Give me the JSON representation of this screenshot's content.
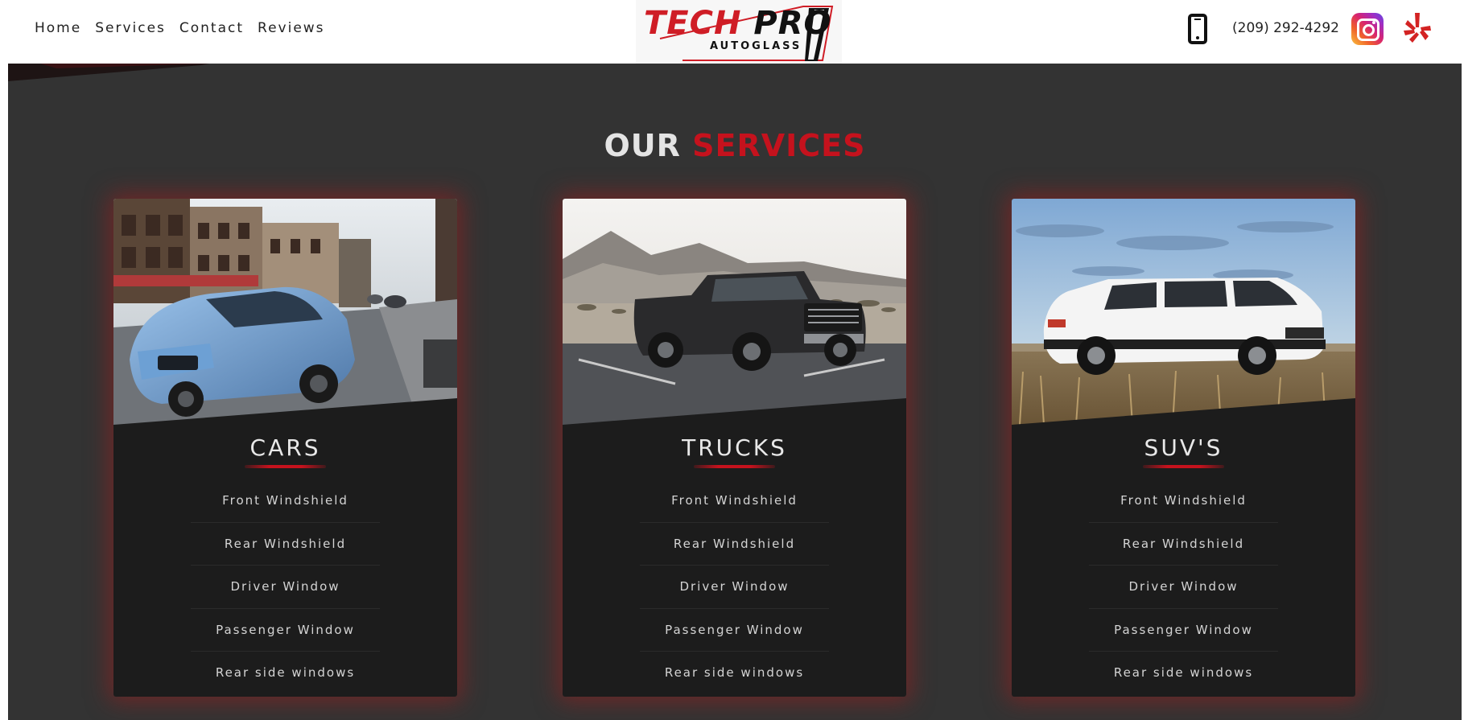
{
  "nav": {
    "items": [
      "Home",
      "Services",
      "Contact",
      "Reviews"
    ]
  },
  "logo": {
    "main_part1": "TECH",
    "main_part2": "PRO",
    "sub": "AUTOGLASS"
  },
  "contact": {
    "phone": "(209) 292-4292",
    "icons": [
      "phone-icon",
      "instagram-icon",
      "yelp-icon"
    ]
  },
  "section": {
    "title_part1": "OUR",
    "title_part2": "SERVICES"
  },
  "colors": {
    "accent": "#c5121d",
    "section_bg": "#333333",
    "card_bg": "#1c1c1c"
  },
  "cards": [
    {
      "title": "CARS",
      "image": "blue-sedan-city-street",
      "services": [
        "Front Windshield",
        "Rear Windshield",
        "Driver Window",
        "Passenger Window",
        "Rear side windows"
      ]
    },
    {
      "title": "TRUCKS",
      "image": "black-pickup-truck-desert",
      "services": [
        "Front Windshield",
        "Rear Windshield",
        "Driver Window",
        "Passenger Window",
        "Rear side windows"
      ]
    },
    {
      "title": "SUV'S",
      "image": "white-suv-field",
      "services": [
        "Front Windshield",
        "Rear Windshield",
        "Driver Window",
        "Passenger Window",
        "Rear side windows"
      ]
    }
  ]
}
